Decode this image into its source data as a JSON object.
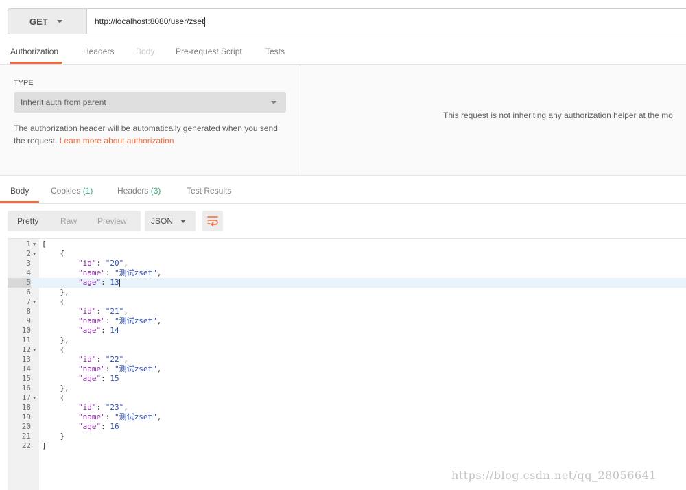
{
  "request": {
    "method": "GET",
    "url": "http://localhost:8080/user/zset"
  },
  "request_tabs": [
    {
      "label": "Authorization",
      "state": "active"
    },
    {
      "label": "Headers",
      "state": "normal"
    },
    {
      "label": "Body",
      "state": "disabled"
    },
    {
      "label": "Pre-request Script",
      "state": "normal"
    },
    {
      "label": "Tests",
      "state": "normal"
    }
  ],
  "auth": {
    "type_label": "TYPE",
    "type_value": "Inherit auth from parent",
    "description": "The authorization header will be automatically generated when you send the request. ",
    "link": "Learn more about authorization",
    "right_message": "This request is not inheriting any authorization helper at the mo"
  },
  "response_tabs": [
    {
      "label": "Body",
      "count": ""
    },
    {
      "label": "Cookies",
      "count": "(1)"
    },
    {
      "label": "Headers",
      "count": "(3)"
    },
    {
      "label": "Test Results",
      "count": ""
    }
  ],
  "body_toolbar": {
    "views": [
      "Pretty",
      "Raw",
      "Preview"
    ],
    "active_view": "Pretty",
    "format": "JSON",
    "wrap_icon": "wrap-lines-icon"
  },
  "code": {
    "highlighted_line": 5,
    "lines": [
      "[",
      "    {",
      "        \"id\": \"20\",",
      "        \"name\": \"测试zset\",",
      "        \"age\": 13",
      "    },",
      "    {",
      "        \"id\": \"21\",",
      "        \"name\": \"测试zset\",",
      "        \"age\": 14",
      "    },",
      "    {",
      "        \"id\": \"22\",",
      "        \"name\": \"测试zset\",",
      "        \"age\": 15",
      "    },",
      "    {",
      "        \"id\": \"23\",",
      "        \"name\": \"测试zset\",",
      "        \"age\": 16",
      "    }",
      "]"
    ],
    "fold_lines": [
      1,
      2,
      7,
      12,
      17
    ]
  },
  "watermark": "https://blog.csdn.net/qq_28056641",
  "colors": {
    "accent": "#f26b3a",
    "count_green": "#3aa876",
    "json_key": "#8a2b9f",
    "json_value": "#2a4fb8"
  }
}
